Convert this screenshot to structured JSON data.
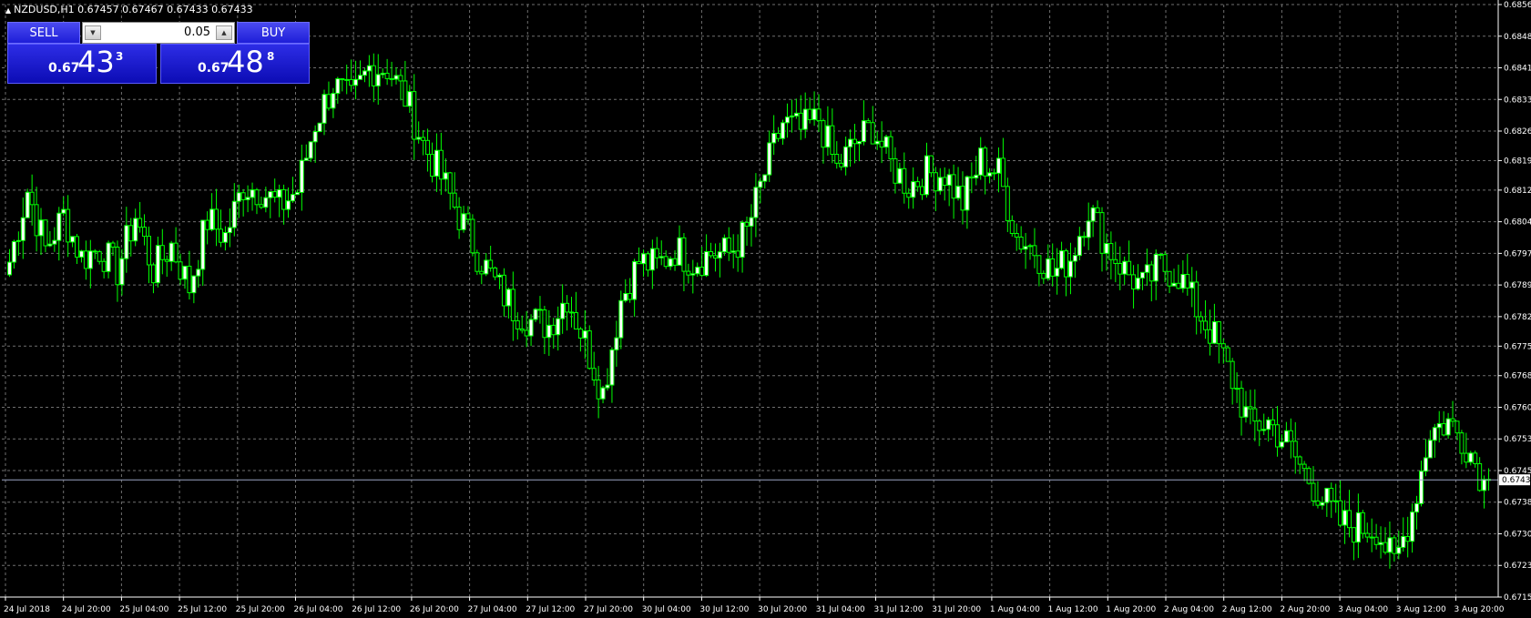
{
  "window": {
    "header_text": "NZDUSD,H1  0.67457 0.67467 0.67433 0.67433",
    "collapse_icon": "triangle-up-icon"
  },
  "trade_panel": {
    "sell_label": "SELL",
    "buy_label": "BUY",
    "lot_value": "0.05",
    "lot_down_icon": "arrow-down-icon",
    "lot_up_icon": "arrow-up-icon",
    "sell_price": {
      "prefix": "0.67",
      "big": "43",
      "sup": "3"
    },
    "buy_price": {
      "prefix": "0.67",
      "big": "48",
      "sup": "8"
    }
  },
  "colors": {
    "background": "#000000",
    "grid": "#6f6f6f",
    "candle_up_fill": "#ffffff",
    "candle_down_fill": "#000000",
    "candle_line": "#00ff00",
    "bid_line": "#9aa3c2",
    "axis_text": "#ffffff",
    "panel_blue": "#1e1ed8"
  },
  "chart_data": {
    "type": "candlestick",
    "symbol": "NZDUSD",
    "timeframe": "H1",
    "ylim": [
      0.67155,
      0.6856
    ],
    "current_price": 0.67433,
    "y_ticks": [
      "0.68560",
      "0.68485",
      "0.68410",
      "0.68335",
      "0.68260",
      "0.68190",
      "0.68120",
      "0.68045",
      "0.67970",
      "0.67895",
      "0.67820",
      "0.67750",
      "0.67680",
      "0.67605",
      "0.67530",
      "0.67455",
      "0.67380",
      "0.67305",
      "0.67230",
      "0.67155"
    ],
    "x_ticks": [
      "24 Jul 2018",
      "24 Jul 20:00",
      "25 Jul 04:00",
      "25 Jul 12:00",
      "25 Jul 20:00",
      "26 Jul 04:00",
      "26 Jul 12:00",
      "26 Jul 20:00",
      "27 Jul 04:00",
      "27 Jul 12:00",
      "27 Jul 20:00",
      "30 Jul 04:00",
      "30 Jul 12:00",
      "30 Jul 20:00",
      "31 Jul 04:00",
      "31 Jul 12:00",
      "31 Jul 20:00",
      "1 Aug 04:00",
      "1 Aug 12:00",
      "1 Aug 20:00",
      "2 Aug 04:00",
      "2 Aug 12:00",
      "2 Aug 20:00",
      "3 Aug 04:00",
      "3 Aug 12:00",
      "3 Aug 20:00"
    ],
    "anchors": [
      0.6795,
      0.6812,
      0.6798,
      0.6806,
      0.6796,
      0.6798,
      0.6793,
      0.6806,
      0.6793,
      0.6799,
      0.6789,
      0.6805,
      0.6801,
      0.6813,
      0.6812,
      0.6808,
      0.6812,
      0.6828,
      0.6837,
      0.6833,
      0.6841,
      0.6841,
      0.6834,
      0.6823,
      0.6815,
      0.6806,
      0.6797,
      0.679,
      0.6784,
      0.6781,
      0.678,
      0.6787,
      0.6776,
      0.6764,
      0.6786,
      0.6795,
      0.6794,
      0.6798,
      0.6795,
      0.6797,
      0.6797,
      0.6802,
      0.6816,
      0.6828,
      0.6826,
      0.6829,
      0.6817,
      0.6823,
      0.6827,
      0.6818,
      0.6813,
      0.6816,
      0.6816,
      0.6809,
      0.6819,
      0.6816,
      0.6801,
      0.6798,
      0.6792,
      0.6796,
      0.6808,
      0.6799,
      0.6793,
      0.6789,
      0.6794,
      0.6792,
      0.6784,
      0.6777,
      0.6767,
      0.6756,
      0.6757,
      0.6752,
      0.6745,
      0.6739,
      0.6733,
      0.6732,
      0.6732,
      0.6723,
      0.6736,
      0.6755,
      0.6757,
      0.6752,
      0.6743
    ]
  }
}
